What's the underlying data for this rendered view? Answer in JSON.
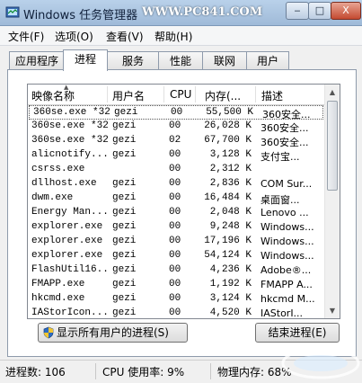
{
  "window": {
    "title": "Windows 任务管理器",
    "watermark": "WWW.PC841.COM",
    "minimize_glyph": "‒",
    "maximize_glyph": "□",
    "close_glyph": "X"
  },
  "menu": [
    {
      "label": "文件(F)"
    },
    {
      "label": "选项(O)"
    },
    {
      "label": "查看(V)"
    },
    {
      "label": "帮助(H)"
    }
  ],
  "tabs": [
    {
      "label": "应用程序",
      "active": false
    },
    {
      "label": "进程",
      "active": true
    },
    {
      "label": "服务",
      "active": false
    },
    {
      "label": "性能",
      "active": false
    },
    {
      "label": "联网",
      "active": false
    },
    {
      "label": "用户",
      "active": false
    }
  ],
  "columns": {
    "image": "映像名称",
    "user": "用户名",
    "cpu": "CPU",
    "memory": "内存(...",
    "description": "描述"
  },
  "rows": [
    {
      "image": "360se.exe *32",
      "user": "gezi",
      "cpu": "00",
      "memory": "55,500 K",
      "desc": "360安全...",
      "selected": true
    },
    {
      "image": "360se.exe *32",
      "user": "gezi",
      "cpu": "00",
      "memory": "26,028 K",
      "desc": "360安全..."
    },
    {
      "image": "360se.exe *32",
      "user": "gezi",
      "cpu": "02",
      "memory": "67,700 K",
      "desc": "360安全..."
    },
    {
      "image": "alicnotify...",
      "user": "gezi",
      "cpu": "00",
      "memory": "3,128 K",
      "desc": "支付宝..."
    },
    {
      "image": "csrss.exe",
      "user": "",
      "cpu": "00",
      "memory": "2,312 K",
      "desc": ""
    },
    {
      "image": "dllhost.exe",
      "user": "gezi",
      "cpu": "00",
      "memory": "2,836 K",
      "desc": "COM Sur..."
    },
    {
      "image": "dwm.exe",
      "user": "gezi",
      "cpu": "00",
      "memory": "16,484 K",
      "desc": "桌面窗..."
    },
    {
      "image": "Energy Man...",
      "user": "gezi",
      "cpu": "00",
      "memory": "2,048 K",
      "desc": "Lenovo ..."
    },
    {
      "image": "explorer.exe",
      "user": "gezi",
      "cpu": "00",
      "memory": "9,248 K",
      "desc": "Windows..."
    },
    {
      "image": "explorer.exe",
      "user": "gezi",
      "cpu": "00",
      "memory": "17,196 K",
      "desc": "Windows..."
    },
    {
      "image": "explorer.exe",
      "user": "gezi",
      "cpu": "00",
      "memory": "54,124 K",
      "desc": "Windows..."
    },
    {
      "image": "FlashUtil16...",
      "user": "gezi",
      "cpu": "00",
      "memory": "4,236 K",
      "desc": "Adobe®..."
    },
    {
      "image": "FMAPP.exe",
      "user": "gezi",
      "cpu": "00",
      "memory": "1,192 K",
      "desc": "FMAPP A..."
    },
    {
      "image": "hkcmd.exe",
      "user": "gezi",
      "cpu": "00",
      "memory": "3,124 K",
      "desc": "hkcmd M..."
    },
    {
      "image": "IAStorIcon...",
      "user": "gezi",
      "cpu": "00",
      "memory": "4,520 K",
      "desc": "IAStorI..."
    }
  ],
  "buttons": {
    "show_all": "显示所有用户的进程(S)",
    "end_process": "结束进程(E)"
  },
  "status": {
    "processes": "进程数: 106",
    "cpu": "CPU 使用率: 9%",
    "memory": "物理内存: 68%"
  },
  "colors": {
    "titlebar": "#b9d1ea",
    "shield_blue": "#2b6cc4",
    "shield_yellow": "#f2c531"
  }
}
